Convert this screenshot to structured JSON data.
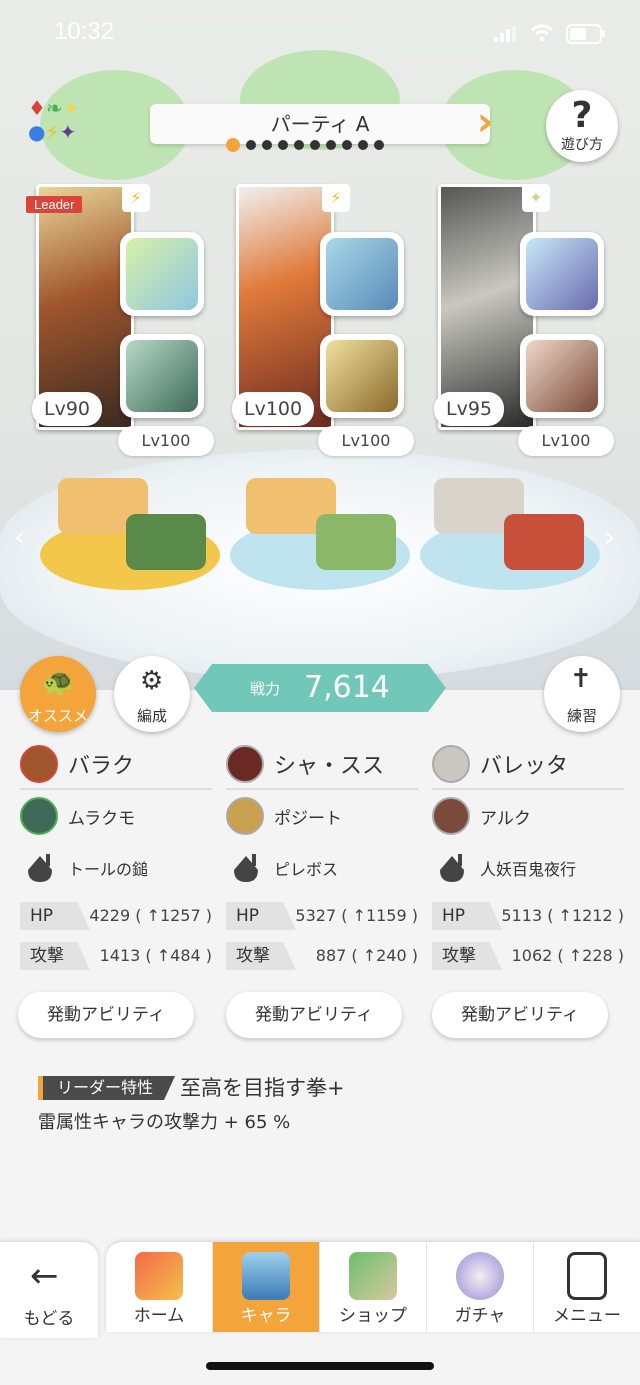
{
  "status_bar": {
    "time": "10:32"
  },
  "party": {
    "title": "パーティ A",
    "page_count": 10,
    "active_page": 1
  },
  "help": {
    "label": "遊び方"
  },
  "members": [
    {
      "level": "Lv90",
      "sub_level": "Lv100",
      "leader": "Leader",
      "element": "⚡"
    },
    {
      "level": "Lv100",
      "sub_level": "Lv100",
      "element": "⚡"
    },
    {
      "level": "Lv95",
      "sub_level": "Lv100",
      "element": "✦"
    }
  ],
  "actions": {
    "recommend": "オススメ",
    "formation": "編成",
    "practice": "練習",
    "power_label": "戦力",
    "power_value": "7,614"
  },
  "columns": [
    {
      "main": "バラク",
      "sub": "ムラクモ",
      "weapon": "トールの鎚",
      "hp_label": "HP",
      "hp": "4229 ( ↑1257 )",
      "atk_label": "攻撃",
      "atk": "1413 ( ↑484 )",
      "ability": "発動アビリティ"
    },
    {
      "main": "シャ・スス",
      "sub": "ポジート",
      "weapon": "ピレボス",
      "hp_label": "HP",
      "hp": "5327 ( ↑1159 )",
      "atk_label": "攻撃",
      "atk": "887 ( ↑240 )",
      "ability": "発動アビリティ"
    },
    {
      "main": "バレッタ",
      "sub": "アルク",
      "weapon": "人妖百鬼夜行",
      "hp_label": "HP",
      "hp": "5113 ( ↑1212 )",
      "atk_label": "攻撃",
      "atk": "1062 ( ↑228 )",
      "ability": "発動アビリティ"
    }
  ],
  "leader_skill": {
    "tag": "リーダー特性",
    "name": "至高を目指す拳+",
    "description": "雷属性キャラの攻撃力 + 65 %"
  },
  "nav": {
    "back": "もどる",
    "items": [
      "ホーム",
      "キャラ",
      "ショップ",
      "ガチャ",
      "メニュー"
    ],
    "active": "キャラ"
  },
  "colors": {
    "accent": "#f3a43a",
    "power": "#72c8b8",
    "leader_red": "#d9443b"
  }
}
